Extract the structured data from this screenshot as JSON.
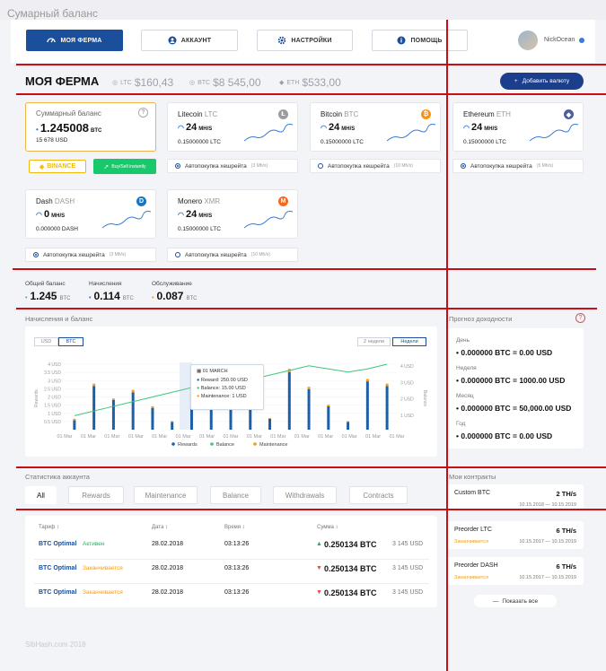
{
  "window_title": "Сумарный баланс",
  "nav": {
    "farm": "МОЯ ФЕРМА",
    "account": "АККАУНТ",
    "settings": "НАСТРОЙКИ",
    "help": "ПОМОЩЬ"
  },
  "user": {
    "name": "NickOcean"
  },
  "header": {
    "title": "МОЯ ФЕРМА",
    "rates": [
      {
        "code": "LTC",
        "value": "$160,43"
      },
      {
        "code": "BTC",
        "value": "$8 545,00"
      },
      {
        "code": "ETH",
        "value": "$533,00"
      }
    ],
    "add_currency": "Добавить валюту"
  },
  "summary_card": {
    "title": "Суммарный баланс",
    "help": "?",
    "value": "1.245008",
    "unit": "BTC",
    "sub": "15 678 USD",
    "exchange": "BINANCE",
    "buy_sell": "Buy/Sell instantly"
  },
  "coins": [
    {
      "name": "Litecoin",
      "code": "LTC",
      "hash": "24",
      "hash_unit": "MH/S",
      "value": "0.15000000 LTC",
      "auto_label": "Автопокупка хешрейта",
      "auto_rate": "(3 Mh/s)",
      "auto_on": true,
      "color": "#9c9c9c",
      "glyph": "Ł"
    },
    {
      "name": "Bitcoin",
      "code": "BTC",
      "hash": "24",
      "hash_unit": "MH/S",
      "value": "0.15000000 LTC",
      "auto_label": "Автопокупка хешрейта",
      "auto_rate": "(10 Mh/s)",
      "auto_on": false,
      "color": "#f7931a",
      "glyph": "₿"
    },
    {
      "name": "Ethereum",
      "code": "ETH",
      "hash": "24",
      "hash_unit": "MH/S",
      "value": "0.15000000 LTC",
      "auto_label": "Автопокупка хешрейта",
      "auto_rate": "(5 Mh/s)",
      "auto_on": true,
      "color": "#4a5f9b",
      "glyph": "◆"
    },
    {
      "name": "Dash",
      "code": "DASH",
      "hash": "0",
      "hash_unit": "MH/S",
      "value": "0.000000 DASH",
      "auto_label": "Автопокупка хешрейта",
      "auto_rate": "(3 Mh/s)",
      "auto_on": true,
      "color": "#1c75bc",
      "glyph": "D"
    },
    {
      "name": "Monero",
      "code": "XMR",
      "hash": "24",
      "hash_unit": "MH/S",
      "value": "0.15000000 LTC",
      "auto_label": "Автопокупка хешрейта",
      "auto_rate": "(10 Mh/s)",
      "auto_on": false,
      "color": "#f26822",
      "glyph": "M"
    }
  ],
  "balances": [
    {
      "label": "Общий баланс",
      "value": "1.245",
      "unit": "BTC",
      "dot": "#2ecc71"
    },
    {
      "label": "Начисления",
      "value": "0.114",
      "unit": "BTC",
      "dot": "#3a7bd5"
    },
    {
      "label": "Обслуживание",
      "value": "0.087",
      "unit": "BTC",
      "dot": "#f39c12"
    }
  ],
  "accruals": {
    "title": "Начисления и баланс",
    "toggle_currency": [
      "USD",
      "BTC"
    ],
    "toggle_period": [
      "2 недели",
      "Недели"
    ]
  },
  "chart_data": {
    "type": "bar",
    "ylabel_left": "Rewards",
    "ylabel_right": "Balance",
    "y_ticks_left": [
      "4 USD",
      "3.5 USD",
      "3 USD",
      "2.5 USD",
      "2 USD",
      "1.5 USD",
      "1 USD",
      "0.5 USD"
    ],
    "y_ticks_right": [
      "4 USD",
      "3 USD",
      "2 USD",
      "1 USD"
    ],
    "x_ticks": [
      "01 Mar",
      "01 Mar",
      "01 Mar",
      "01 Mar",
      "01 Mar",
      "01 Mar",
      "01 Mar",
      "01 Mar",
      "01 Mar",
      "01 Mar",
      "01 Mar",
      "01 Mar",
      "01 Mar",
      "01 Mar",
      "01 Mar"
    ],
    "rewards": [
      0.6,
      2.8,
      1.9,
      2.4,
      1.4,
      0.5,
      2.8,
      3.6,
      1.5,
      2.7,
      0.7,
      3.7,
      2.6,
      1.5,
      0.5,
      3.1,
      2.8
    ],
    "maintenance": [
      0.1,
      0.15,
      0.1,
      0.15,
      0.1,
      0.05,
      0.15,
      0.2,
      0.1,
      0.15,
      0.05,
      0.2,
      0.15,
      0.1,
      0.05,
      0.15,
      0.15
    ],
    "balance": [
      0.9,
      1.2,
      1.5,
      1.8,
      2.1,
      2.4,
      2.7,
      2.75,
      3.0,
      3.2,
      3.5,
      3.8,
      4.1,
      3.9,
      3.7,
      3.9,
      4.2
    ],
    "ylim": [
      0,
      4.2
    ],
    "legend": [
      "Rewards",
      "Balance",
      "Maintenance"
    ],
    "colors": {
      "rewards": "#1c5fa8",
      "balance": "#3ec67a",
      "maintenance": "#f39c12"
    },
    "tooltip": {
      "date": "01 MARCH",
      "reward_label": "Reward:",
      "reward_value": "250.00 USD",
      "balance_label": "Balance:",
      "balance_value": "15.00 USD",
      "maintenance_label": "Maintenance:",
      "maintenance_value": "1 USD"
    }
  },
  "forecast": {
    "title": "Прогноз доходности",
    "help": "?",
    "items": [
      {
        "label": "День",
        "value": "0.000000 BTC = 0.00 USD"
      },
      {
        "label": "Неделя",
        "value": "0.000000 BTC = 1000.00 USD"
      },
      {
        "label": "Месяц",
        "value": "0.000000 BTC = 50,000.00 USD"
      },
      {
        "label": "Год",
        "value": "0.000000 BTC = 0.00 USD"
      }
    ]
  },
  "stats": {
    "title": "Статистика аккаунта",
    "tabs": [
      "All",
      "Rewards",
      "Maintenance",
      "Balance",
      "Withdrawals",
      "Contracts"
    ],
    "headers": [
      "Тариф ↕",
      "Дата ↕",
      "Время ↕",
      "Сумма ↕"
    ],
    "rows": [
      {
        "plan": "BTC Optimal",
        "status": "Активен",
        "status_color": "#27ae60",
        "date": "28.02.2018",
        "time": "03:13:26",
        "direction": "up",
        "amount": "0.250134 BTC",
        "usd": "3 145 USD"
      },
      {
        "plan": "BTC Optimal",
        "status": "Заканчивается",
        "status_color": "#f39c12",
        "date": "28.02.2018",
        "time": "03:13:26",
        "direction": "down",
        "amount": "0.250134 BTC",
        "usd": "3 145 USD"
      },
      {
        "plan": "BTC Optimal",
        "status": "Заканчивается",
        "status_color": "#f39c12",
        "date": "28.02.2018",
        "time": "03:13:26",
        "direction": "down",
        "amount": "0.250134 BTC",
        "usd": "3 145 USD"
      }
    ]
  },
  "contracts": {
    "title": "Мои контракты",
    "items": [
      {
        "name": "Custom BTC",
        "value": "2 TH/s",
        "status": "",
        "dates": "10.15.2018 — 10.15.2019"
      },
      {
        "name": "Preorder LTC",
        "value": "6 TH/s",
        "status": "Заканчивается",
        "dates": "10.15.2017 — 10.15.2019"
      },
      {
        "name": "Preorder DASH",
        "value": "6 TH/s",
        "status": "Заканчивается",
        "dates": "10.15.2017 — 10.15.2019"
      }
    ],
    "show_all": "Показать все"
  },
  "footer": "SibHash.com 2018"
}
